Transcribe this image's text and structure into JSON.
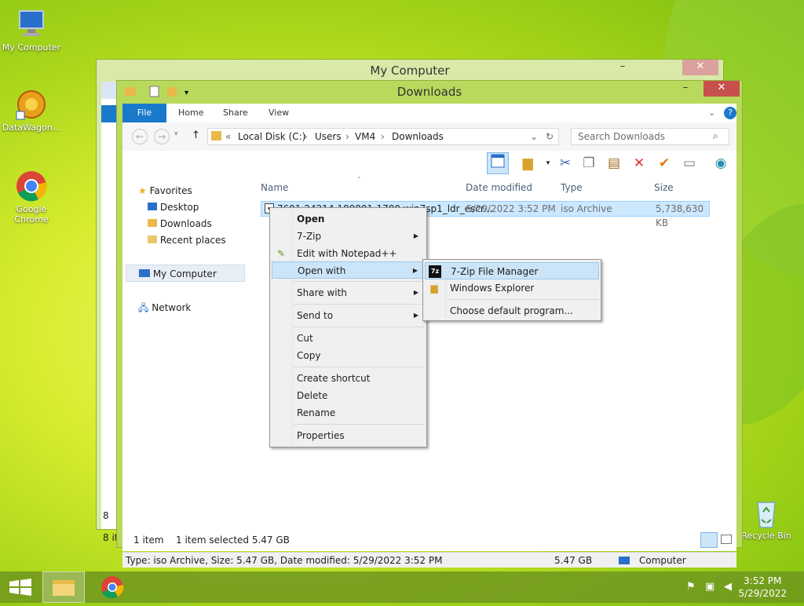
{
  "desktop": {
    "icons": [
      {
        "label": "My Computer"
      },
      {
        "label": "DataWagon..."
      },
      {
        "label": "Google Chrome"
      },
      {
        "label": "Recycle Bin"
      }
    ]
  },
  "back_window": {
    "title": "My Computer",
    "status_fragment": "8 it",
    "side_fragment": "8"
  },
  "window": {
    "title": "Downloads",
    "controls": {
      "minimize": "–",
      "maximize": "☐",
      "close": "✕"
    },
    "tabs": [
      "File",
      "Home",
      "Share",
      "View"
    ],
    "address": {
      "prefix": "«",
      "crumbs": [
        "Local Disk (C:)",
        "Users",
        "VM4",
        "Downloads"
      ]
    },
    "search_placeholder": "Search Downloads",
    "nav": {
      "favorites": "Favorites",
      "desktop": "Desktop",
      "downloads": "Downloads",
      "recent": "Recent places",
      "my_computer": "My Computer",
      "network": "Network"
    },
    "columns": {
      "name": "Name",
      "date": "Date modified",
      "type": "Type",
      "size": "Size"
    },
    "file": {
      "name": "7601.24214.180801-1700.win7sp1_ldr_escr...",
      "date": "5/29/2022 3:52 PM",
      "type": "iso Archive",
      "size": "5,738,630 KB"
    },
    "status": {
      "count": "1 item",
      "selected": "1 item selected  5.47 GB"
    },
    "details": {
      "info": "Type: iso Archive, Size: 5.47 GB, Date modified: 5/29/2022 3:52 PM",
      "size": "5.47 GB",
      "location": "Computer"
    }
  },
  "context_menu": {
    "items": {
      "open": "Open",
      "sevenzip": "7-Zip",
      "notepad": "Edit with Notepad++",
      "open_with": "Open with",
      "share_with": "Share with",
      "send_to": "Send to",
      "cut": "Cut",
      "copy": "Copy",
      "create_shortcut": "Create shortcut",
      "delete": "Delete",
      "rename": "Rename",
      "properties": "Properties"
    }
  },
  "submenu": {
    "items": {
      "sevenzip_fm": "7-Zip File Manager",
      "explorer": "Windows Explorer",
      "choose_default": "Choose default program..."
    }
  },
  "taskbar": {
    "clock_time": "3:52 PM",
    "clock_date": "5/29/2022"
  },
  "colors": {
    "accent": "#1979ca",
    "selection": "#cce8ff",
    "close": "#c7504d",
    "frame": "#b9d95c"
  }
}
